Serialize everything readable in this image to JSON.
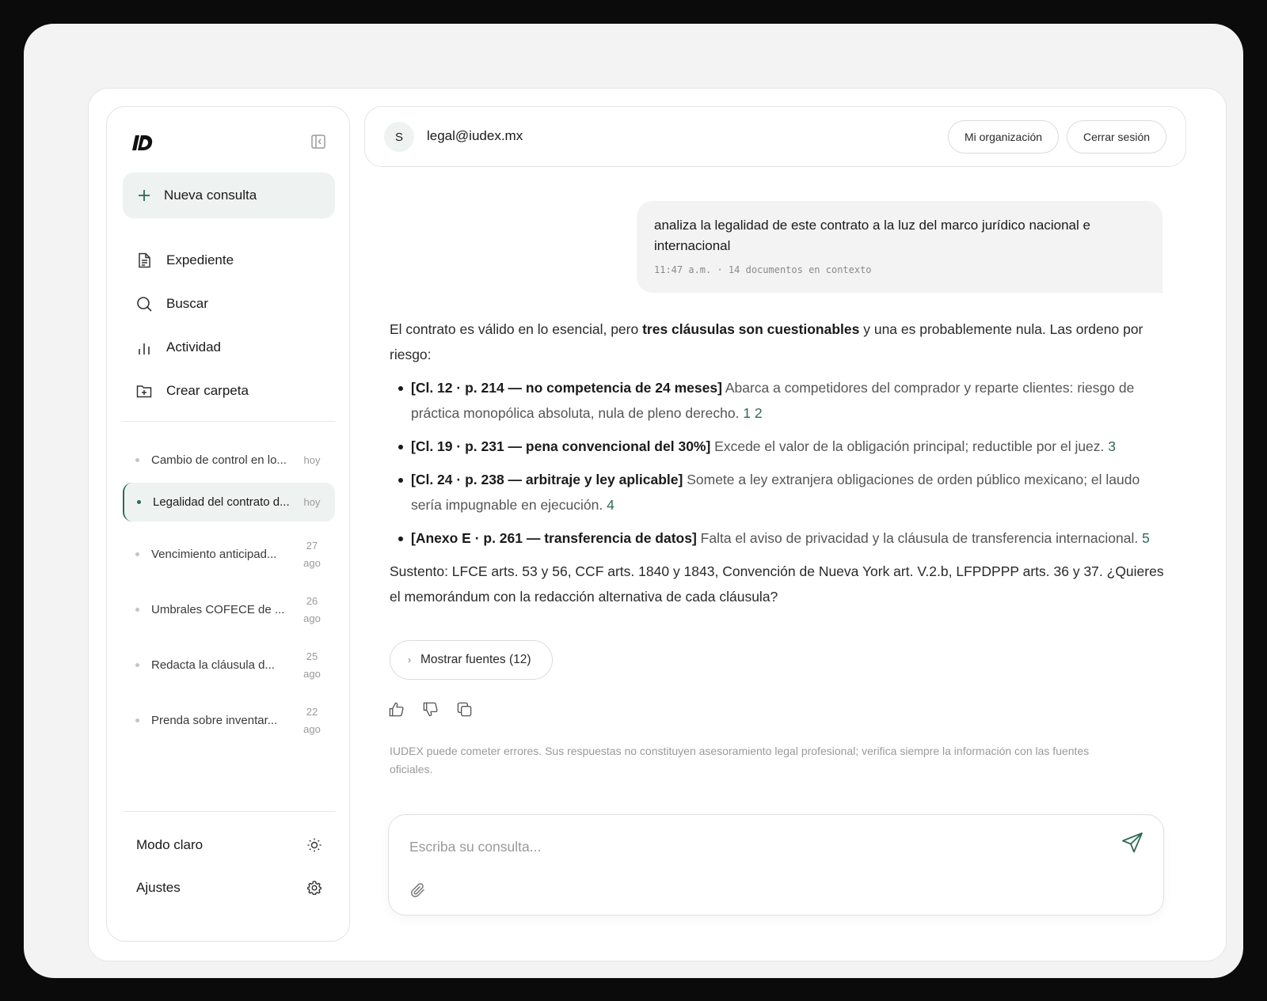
{
  "sidebar": {
    "new_label": "Nueva consulta",
    "nav": [
      {
        "label": "Expediente",
        "icon": "document-icon"
      },
      {
        "label": "Buscar",
        "icon": "search-icon"
      },
      {
        "label": "Actividad",
        "icon": "bar-chart-icon"
      },
      {
        "label": "Crear carpeta",
        "icon": "folder-plus-icon"
      }
    ],
    "history": [
      {
        "title": "Cambio de control en lo...",
        "date": "hoy",
        "active": false
      },
      {
        "title": "Legalidad del contrato d...",
        "date": "hoy",
        "active": true
      },
      {
        "title": "Vencimiento anticipad...",
        "date": "27 ago",
        "active": false
      },
      {
        "title": "Umbrales COFECE de ...",
        "date": "26 ago",
        "active": false
      },
      {
        "title": "Redacta la cláusula d...",
        "date": "25 ago",
        "active": false
      },
      {
        "title": "Prenda sobre inventar...",
        "date": "22 ago",
        "active": false
      }
    ],
    "theme_label": "Modo claro",
    "settings_label": "Ajustes"
  },
  "header": {
    "avatar_initial": "S",
    "email": "legal@iudex.mx",
    "org_label": "Mi organización",
    "logout_label": "Cerrar sesión"
  },
  "user_message": {
    "text": "analiza la legalidad de este contrato a la luz del marco jurídico nacional e internacional",
    "meta": "11:47 a.m. · 14 documentos en contexto"
  },
  "answer": {
    "intro_pre": "El contrato es válido en lo esencial, pero ",
    "intro_bold": "tres cláusulas son cuestionables",
    "intro_post": " y una es probablemente nula. Las ordeno por riesgo:",
    "items": [
      {
        "head": "[Cl. 12 · p. 214 — no competencia de 24 meses]",
        "body": " Abarca a competidores del comprador y reparte clientes: riesgo de práctica monopólica absoluta, nula de pleno derecho.",
        "cites": "1 2"
      },
      {
        "head": "[Cl. 19 · p. 231 — pena convencional del 30%]",
        "body": " Excede el valor de la obligación principal; reductible por el juez.",
        "cites": "3"
      },
      {
        "head": "[Cl. 24 · p. 238 — arbitraje y ley aplicable]",
        "body": " Somete a ley extranjera obligaciones de orden público mexicano; el laudo sería impugnable en ejecución.",
        "cites": "4"
      },
      {
        "head": "[Anexo E · p. 261 — transferencia de datos]",
        "body": " Falta el aviso de privacidad y la cláusula de transferencia internacional.",
        "cites": "5"
      }
    ],
    "closing": "Sustento: LFCE arts. 53 y 56, CCF arts. 1840 y 1843, Convención de Nueva York art. V.2.b, LFPDPPP arts. 36 y 37. ¿Quieres el memorándum con la redacción alternativa de cada cláusula?",
    "sources_label": "Mostrar fuentes (12)"
  },
  "disclaimer": "IUDEX puede cometer errores. Sus respuestas no constituyen asesoramiento legal profesional; verifica siempre la información con las fuentes oficiales.",
  "composer": {
    "placeholder": "Escriba su consulta...",
    "value": ""
  },
  "colors": {
    "accent": "#2d6b55",
    "accent_soft": "#eef3f1"
  }
}
